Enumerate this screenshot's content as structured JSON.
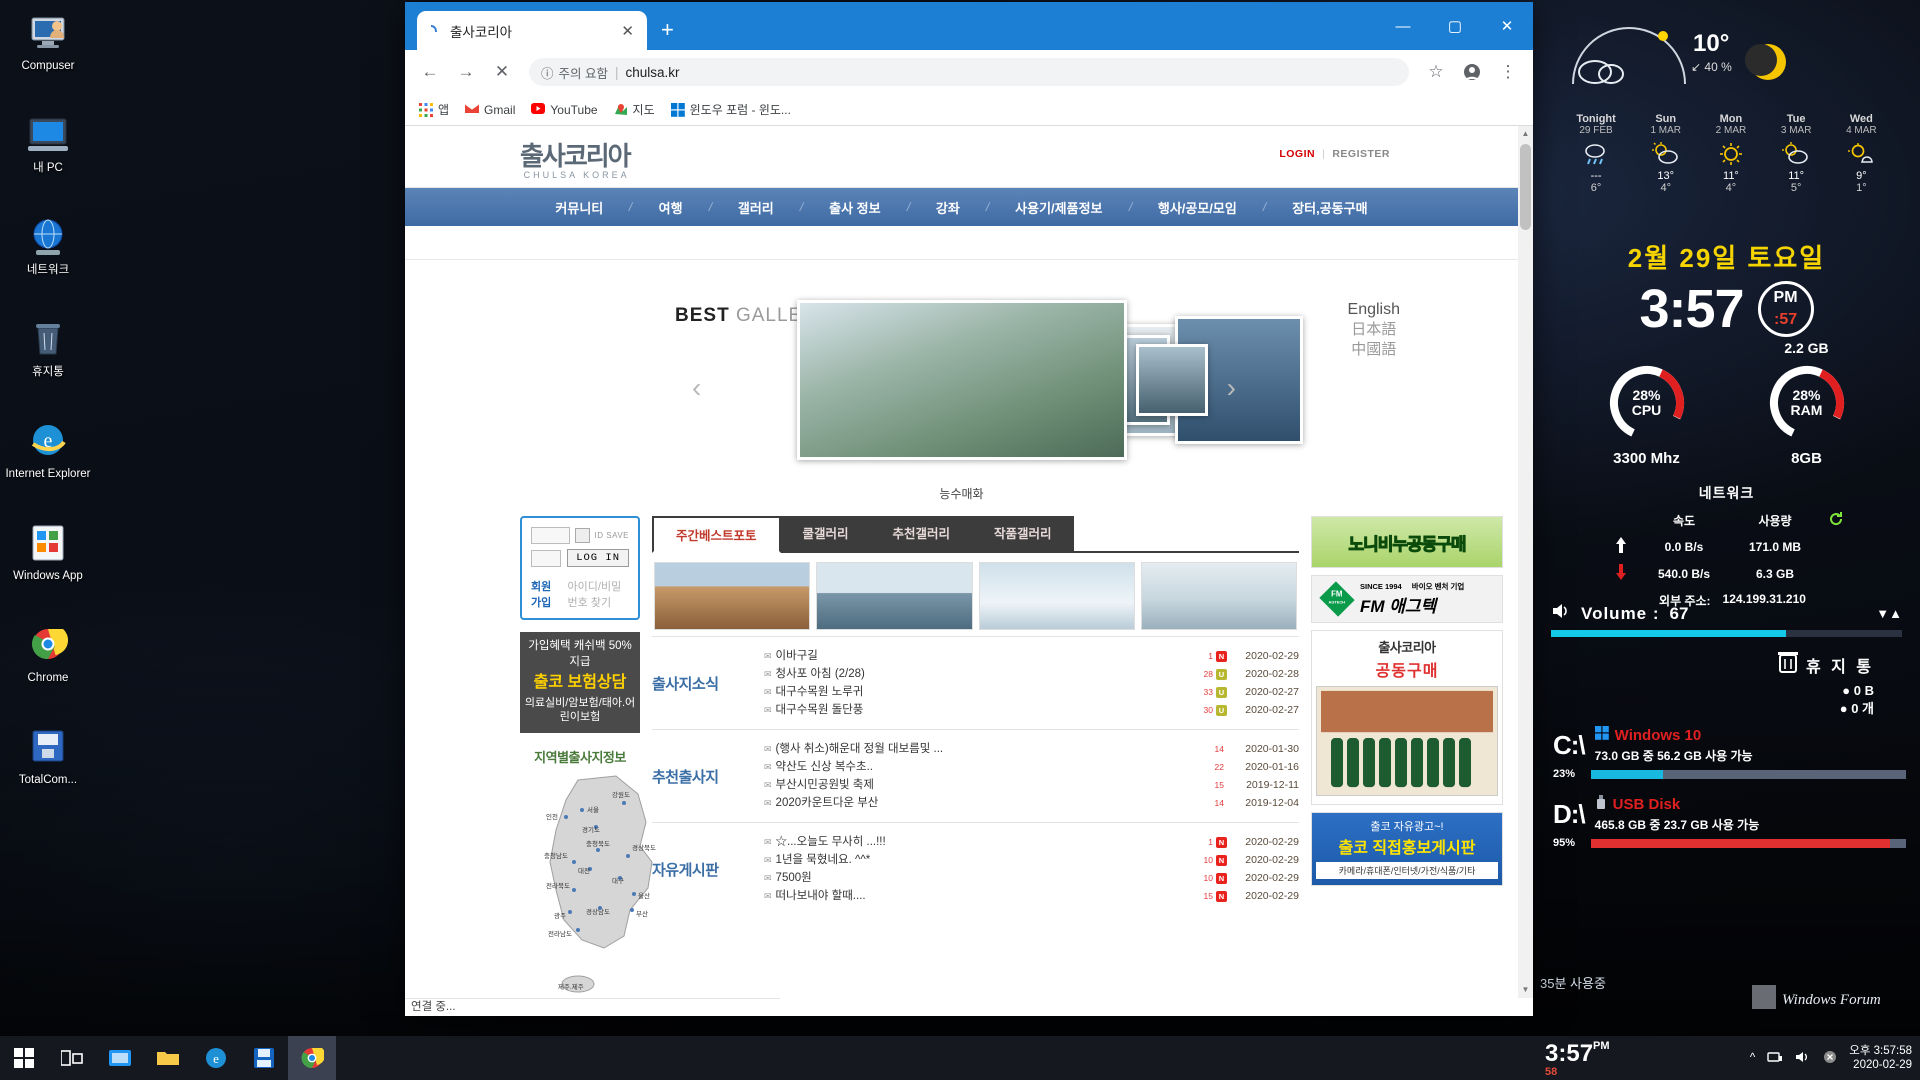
{
  "desktop": {
    "icons": [
      {
        "label": "Compuser",
        "icon": "computer-person-icon"
      },
      {
        "label": "내 PC",
        "icon": "my-pc-icon"
      },
      {
        "label": "네트워크",
        "icon": "network-globe-icon"
      },
      {
        "label": "휴지통",
        "icon": "recycle-bin-icon"
      },
      {
        "label": "Internet Explorer",
        "icon": "internet-explorer-icon"
      },
      {
        "label": "Windows App",
        "icon": "windows-app-icon"
      },
      {
        "label": "Chrome",
        "icon": "chrome-icon"
      },
      {
        "label": "TotalCom...",
        "icon": "total-commander-icon"
      }
    ],
    "forum_watermark": "Windows Forum",
    "cursor_note": "35분 사용중"
  },
  "browser": {
    "tab_title": "출사코리아",
    "tab_close": "✕",
    "new_tab": "+",
    "window_buttons": {
      "minimize": "—",
      "maximize": "▢",
      "close": "✕"
    },
    "nav": {
      "back": "←",
      "forward": "→",
      "stop": "✕"
    },
    "omnibox": {
      "security_label": "주의 요함",
      "url": "chulsa.kr",
      "star": "☆",
      "profile": "●",
      "menu": "⋮"
    },
    "bookmarks": [
      {
        "label": "앱",
        "icon": "apps-grid-icon"
      },
      {
        "label": "Gmail",
        "icon": "gmail-icon"
      },
      {
        "label": "YouTube",
        "icon": "youtube-icon"
      },
      {
        "label": "지도",
        "icon": "maps-icon"
      },
      {
        "label": "윈도우 포럼 - 윈도...",
        "icon": "windows-icon"
      }
    ],
    "status_text": "연결 중..."
  },
  "site": {
    "logo_kr": "출사코리아",
    "logo_en": "CHULSA KOREA",
    "auth": {
      "login": "LOGIN",
      "divider": "|",
      "register": "REGISTER"
    },
    "nav_items": [
      "커뮤니티",
      "여행",
      "갤러리",
      "출사 정보",
      "강좌",
      "사용기/제품정보",
      "행사/공모/모임",
      "장터,공동구매"
    ],
    "hero": {
      "best": "BEST",
      "gallery": "GALLERY",
      "languages": [
        "English",
        "日本語",
        "中國語"
      ],
      "caption": "능수매화",
      "prev_arrow": "‹",
      "next_arrow": "›"
    },
    "login_box": {
      "id_placeholder": "",
      "pw_placeholder": "",
      "id_save_label": "ID SAVE",
      "login_button": "LOG IN",
      "join": "회원 가입",
      "find": "아이디/비밀번호 찾기"
    },
    "insurance_banner": {
      "line1": "가입혜택 캐쉬백 50%지급",
      "line2": "출코 보험상담",
      "line3": "의료실비/암보험/태아.어린이보험"
    },
    "region_header": "지역별출사지정보",
    "map_labels": [
      "서울",
      "인천",
      "경기도",
      "강원도",
      "충청북도",
      "충청남도",
      "경상북도",
      "대전",
      "대구",
      "전라북도",
      "울산",
      "광주",
      "경상남도",
      "부산",
      "전라남도",
      "제주.제주"
    ],
    "gallery_tabs": [
      {
        "label": "주간베스트포토",
        "active": true
      },
      {
        "label": "쿨갤러리",
        "active": false
      },
      {
        "label": "추천갤러리",
        "active": false
      },
      {
        "label": "작품갤러리",
        "active": false
      }
    ],
    "news_sections": [
      {
        "category": "출사지소식",
        "rows": [
          {
            "title": "이바구길",
            "count": "1",
            "badge": "N",
            "date": "2020-02-29"
          },
          {
            "title": "청사포 아침 (2/28)",
            "count": "28",
            "badge": "U",
            "date": "2020-02-28"
          },
          {
            "title": "대구수목원 노루귀",
            "count": "33",
            "badge": "U",
            "date": "2020-02-27"
          },
          {
            "title": "대구수목원 돌단풍",
            "count": "30",
            "badge": "U",
            "date": "2020-02-27"
          }
        ]
      },
      {
        "category": "추천출사지",
        "rows": [
          {
            "title": "(행사 취소)해운대 정월 대보름및 ...",
            "count": "14",
            "badge": "",
            "date": "2020-01-30"
          },
          {
            "title": "약산도 신상 복수초..",
            "count": "22",
            "badge": "",
            "date": "2020-01-16"
          },
          {
            "title": "부산시민공원빛 축제",
            "count": "15",
            "badge": "",
            "date": "2019-12-11"
          },
          {
            "title": "2020카운트다운 부산",
            "count": "14",
            "badge": "",
            "date": "2019-12-04"
          }
        ]
      },
      {
        "category": "자유게시판",
        "rows": [
          {
            "title": "☆...오늘도 무사히 ...!!!",
            "count": "1",
            "badge": "N",
            "date": "2020-02-29"
          },
          {
            "title": "1년을 묵혔네요. ^^*",
            "count": "10",
            "badge": "N",
            "date": "2020-02-29"
          },
          {
            "title": "7500원",
            "count": "10",
            "badge": "N",
            "date": "2020-02-29"
          },
          {
            "title": "떠나보내야 할때....",
            "count": "15",
            "badge": "N",
            "date": "2020-02-29"
          }
        ]
      }
    ],
    "banners": {
      "noni": "노니비누공동구매",
      "fm": {
        "since": "SINCE 1994",
        "venture": "바이오 벤처 기업",
        "name": "FM 애그텍",
        "diamond_top": "FM",
        "diamond_bottom": "AGTECH"
      },
      "coop": {
        "line1": "출사코리아",
        "line2": "공동구매"
      },
      "ad": {
        "line1": "출코 자유광고~!",
        "line2": "출코 직접홍보게시판",
        "line3": "카메라/휴대폰/인터넷/가전/식품/기타"
      }
    }
  },
  "widget": {
    "current": {
      "temp": "10°",
      "precip": "40 %",
      "precip_arrow": "↙"
    },
    "forecast": [
      {
        "day": "Tonight",
        "date": "29 FEB",
        "icon": "rain-icon",
        "hi": "---",
        "lo": "6°"
      },
      {
        "day": "Sun",
        "date": "1 MAR",
        "icon": "partly-cloudy-icon",
        "hi": "13°",
        "lo": "4°"
      },
      {
        "day": "Mon",
        "date": "2 MAR",
        "icon": "sunny-icon",
        "hi": "11°",
        "lo": "4°"
      },
      {
        "day": "Tue",
        "date": "3 MAR",
        "icon": "partly-cloudy-icon",
        "hi": "11°",
        "lo": "5°"
      },
      {
        "day": "Wed",
        "date": "4 MAR",
        "icon": "partly-sunny-icon",
        "hi": "9°",
        "lo": "1°"
      }
    ],
    "big_date": "2월 29일 토요일",
    "clock": "3:57",
    "meridiem": "PM",
    "seconds": ":57",
    "cpu": {
      "percent": "28%",
      "label": "CPU",
      "sub": "3300 Mhz",
      "value": 28
    },
    "ram": {
      "percent": "28%",
      "label": "RAM",
      "sub": "8GB",
      "used": "2.2 GB",
      "value": 28
    },
    "network": {
      "title": "네트워크",
      "col_speed": "속도",
      "col_usage": "사용량",
      "up_speed": "0.0 B/s",
      "up_usage": "171.0 MB",
      "down_speed": "540.0 B/s",
      "down_usage": "6.3 GB",
      "ext_label": "외부 주소:",
      "ext_ip": "124.199.31.210"
    },
    "volume": {
      "label": "Volume :",
      "value": "67",
      "percent": 67
    },
    "recycle": {
      "label": "휴 지 통",
      "size": "0 B",
      "count": "0 개"
    },
    "drives": [
      {
        "letter": "C:\\",
        "name": "Windows 10",
        "info": "73.0 GB 중  56.2 GB 사용 가능",
        "percent": "23%",
        "value": 23,
        "color": "#18b8e0",
        "icon": "windows-logo-icon"
      },
      {
        "letter": "D:\\",
        "name": "USB Disk",
        "info": "465.8 GB 중 23.7 GB 사용 가능",
        "percent": "95%",
        "value": 95,
        "color": "#e03030",
        "icon": "usb-disk-icon"
      }
    ]
  },
  "taskbar": {
    "start": "windows-start-icon",
    "items": [
      {
        "icon": "task-view-icon"
      },
      {
        "icon": "file-explorer-blue-icon"
      },
      {
        "icon": "folder-icon"
      },
      {
        "icon": "internet-explorer-icon"
      },
      {
        "icon": "save-disk-icon"
      },
      {
        "icon": "chrome-icon"
      }
    ],
    "clock": "3:57",
    "clock_pm": "PM",
    "clock_sec": "58",
    "tray": {
      "chevron": "^",
      "network": "network-icon",
      "volume": "volume-icon",
      "action": "action-center-icon"
    },
    "tray_time": "오후 3:57:58",
    "tray_date": "2020-02-29"
  }
}
